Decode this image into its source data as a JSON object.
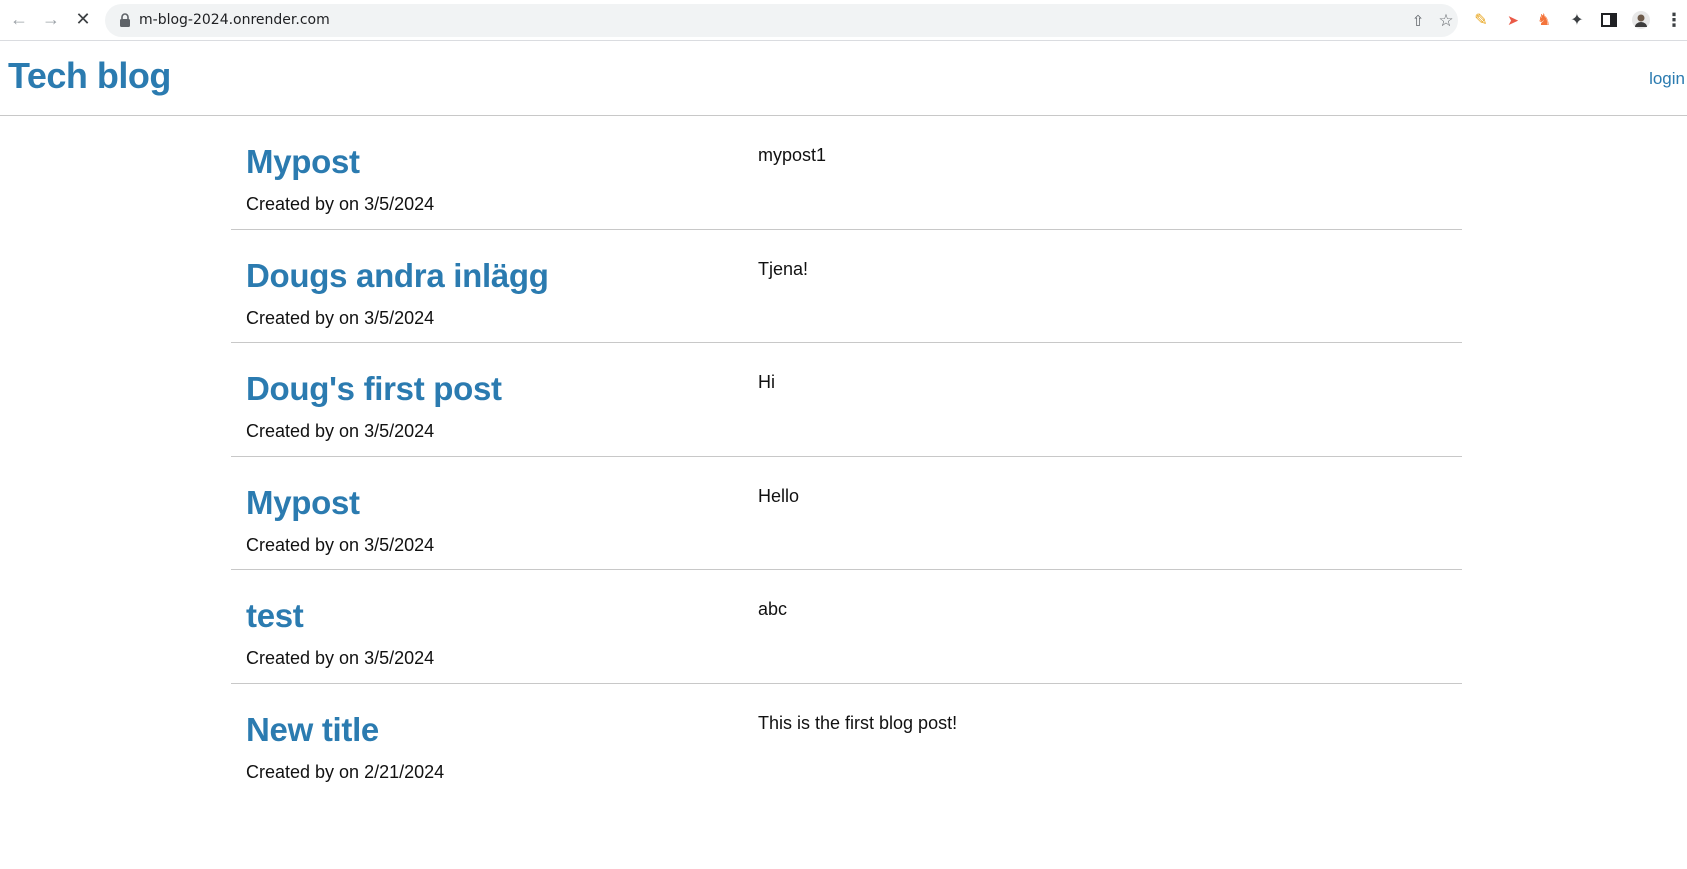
{
  "browser": {
    "url": "m-blog-2024.onrender.com"
  },
  "site": {
    "brand": "Tech blog",
    "login_label": "login",
    "accent_color": "#2b7bb0"
  },
  "posts": [
    {
      "title": "Mypost",
      "meta": "Created by on 3/5/2024",
      "body": "mypost1"
    },
    {
      "title": "Dougs andra inlägg",
      "meta": "Created by on 3/5/2024",
      "body": "Tjena!"
    },
    {
      "title": "Doug's first post",
      "meta": "Created by on 3/5/2024",
      "body": "Hi"
    },
    {
      "title": "Mypost",
      "meta": "Created by on 3/5/2024",
      "body": "Hello"
    },
    {
      "title": "test",
      "meta": "Created by on 3/5/2024",
      "body": "abc"
    },
    {
      "title": "New title",
      "meta": "Created by on 2/21/2024",
      "body": "This is the first blog post!"
    }
  ]
}
